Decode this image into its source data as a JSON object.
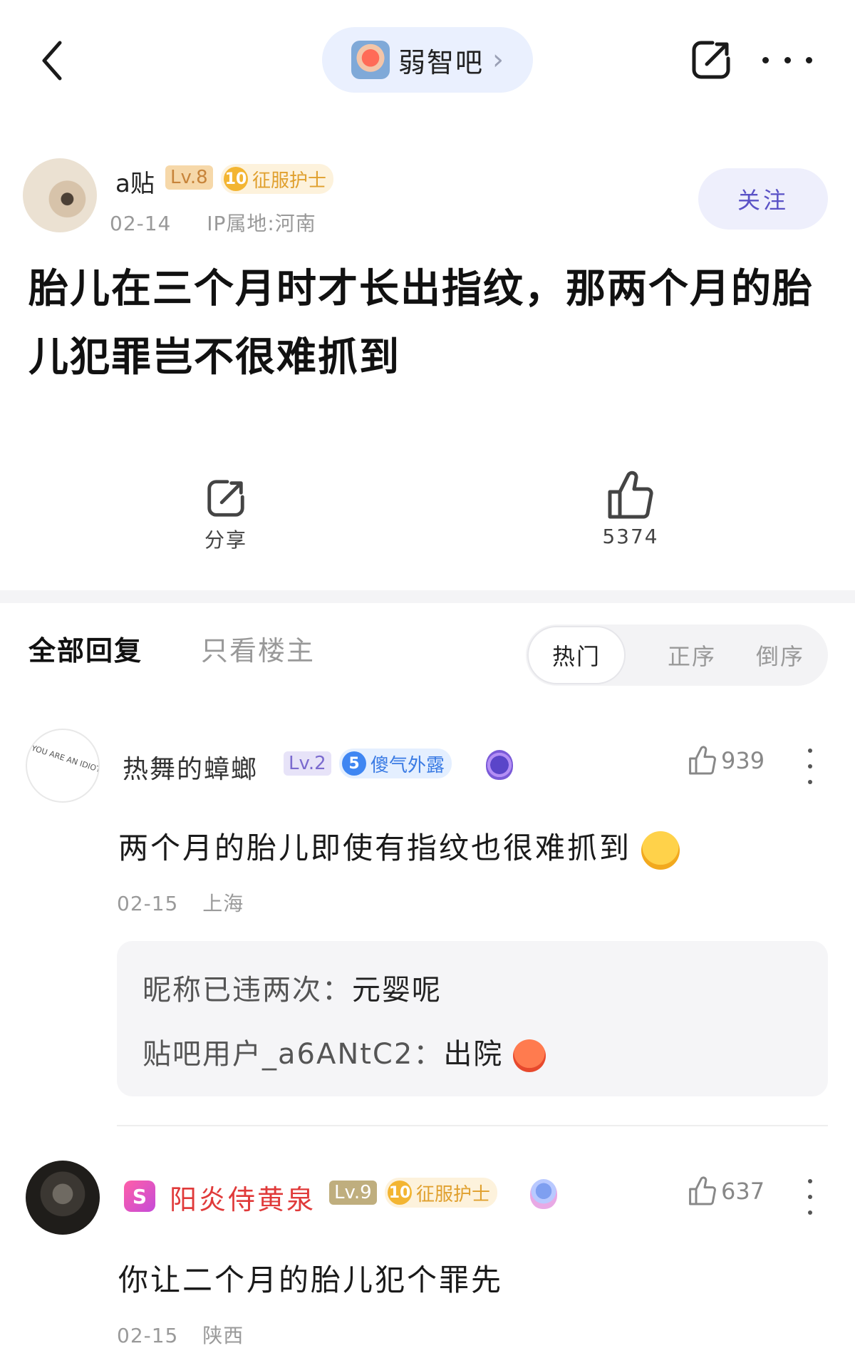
{
  "header": {
    "forum_name": "弱智吧",
    "forum_chevron": "›"
  },
  "post": {
    "author_name": "a贴",
    "author_level": "Lv.8",
    "author_badge_num": "10",
    "author_badge_label": "征服护士",
    "date": "02-14",
    "ip_location": "IP属地:河南",
    "follow_label": "关注",
    "title": "胎儿在三个月时才长出指纹，那两个月的胎儿犯罪岂不很难抓到",
    "share_label": "分享",
    "like_count": "5374"
  },
  "tabs": {
    "all_replies": "全部回复",
    "op_only": "只看楼主",
    "sort_hot": "热门",
    "sort_asc": "正序",
    "sort_desc": "倒序"
  },
  "comments": [
    {
      "username": "热舞的蟑螂",
      "level": "Lv.2",
      "badge_num": "5",
      "badge_label": "傻气外露",
      "avatar_text": "YOU ARE AN IDIOT",
      "likes": "939",
      "text": "两个月的胎儿即使有指纹也很难抓到",
      "date": "02-15",
      "location": "上海",
      "replies": [
        {
          "author": "昵称已违两次",
          "text": "元婴呢"
        },
        {
          "author": "贴吧用户_a6ANtC2",
          "text": "出院"
        }
      ]
    },
    {
      "username": "阳炎侍黄泉",
      "vip_label": "S",
      "level": "Lv.9",
      "badge_num": "10",
      "badge_label": "征服护士",
      "likes": "637",
      "text": "你让二个月的胎儿犯个罪先",
      "date": "02-15",
      "location": "陕西"
    }
  ],
  "icons": {
    "back": "chevron-left-icon",
    "share": "share-icon",
    "more": "more-horizontal-icon",
    "like": "thumbs-up-icon",
    "more_vertical": "more-vertical-icon"
  },
  "colors": {
    "forum_pill_bg": "#eaf0fe",
    "follow_text": "#5a52c6",
    "vip_name": "#e03a3a",
    "badge_gold": "#f3b532",
    "badge_blue": "#3f86f2"
  }
}
